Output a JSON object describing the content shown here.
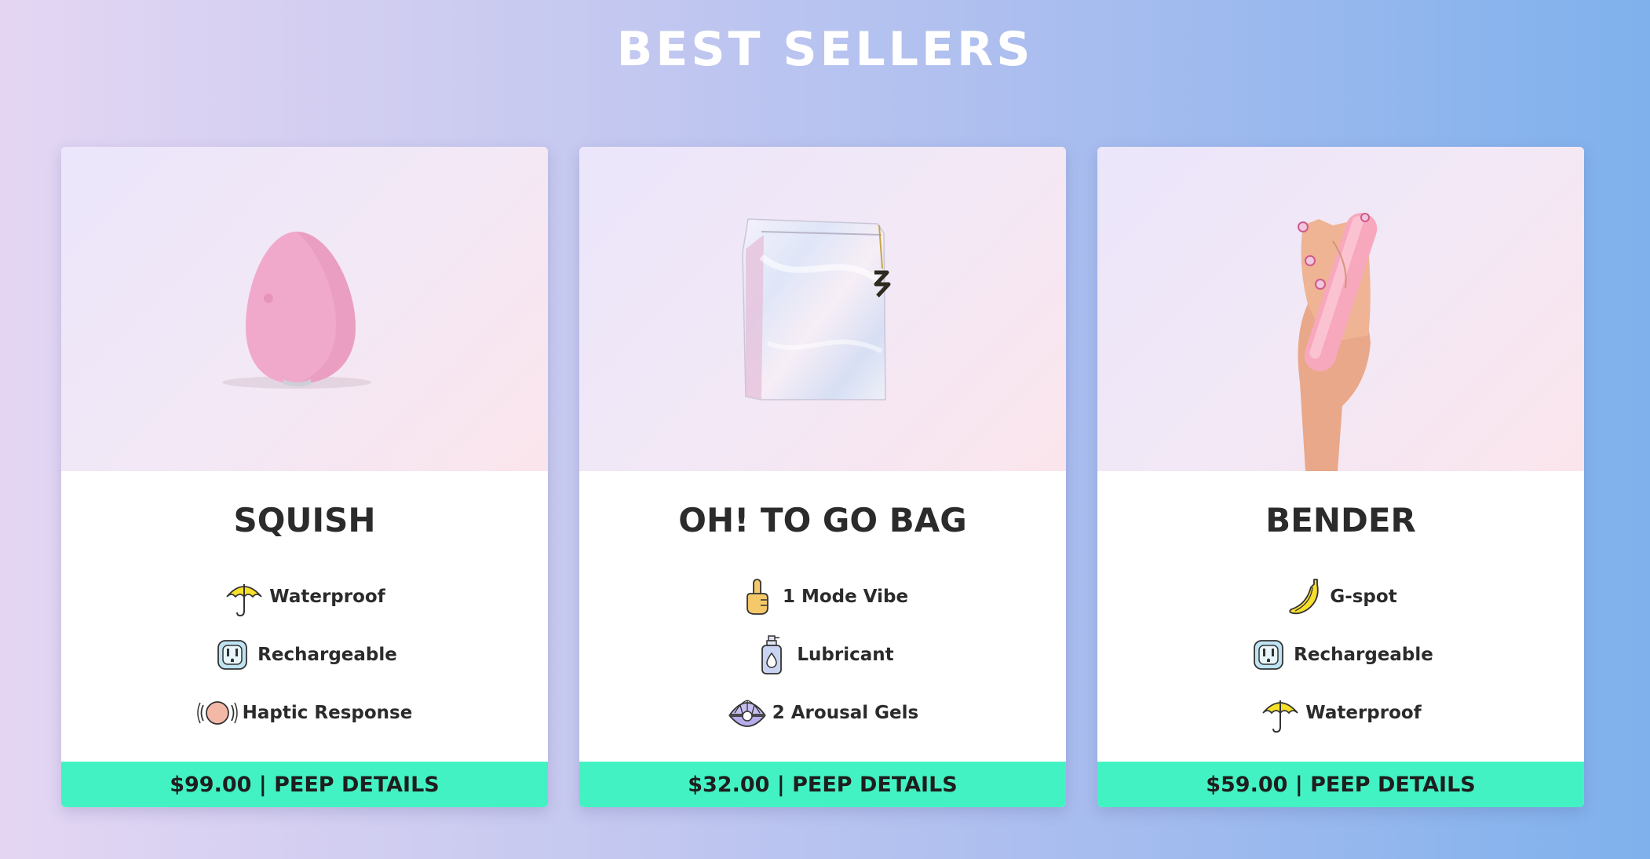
{
  "section": {
    "title": "BEST SELLERS"
  },
  "products": [
    {
      "name": "SQUISH",
      "features": [
        {
          "icon": "umbrella-icon",
          "label": "Waterproof"
        },
        {
          "icon": "outlet-icon",
          "label": "Rechargeable"
        },
        {
          "icon": "haptic-icon",
          "label": "Haptic Response"
        }
      ],
      "price": "$99.00",
      "cta": "PEEP DETAILS"
    },
    {
      "name": "OH! TO GO BAG",
      "features": [
        {
          "icon": "pointing-finger-icon",
          "label": "1 Mode Vibe"
        },
        {
          "icon": "lubricant-bottle-icon",
          "label": "Lubricant"
        },
        {
          "icon": "oyster-pearl-icon",
          "label": "2 Arousal Gels"
        }
      ],
      "price": "$32.00",
      "cta": "PEEP DETAILS"
    },
    {
      "name": "BENDER",
      "features": [
        {
          "icon": "banana-icon",
          "label": "G-spot"
        },
        {
          "icon": "outlet-icon",
          "label": "Rechargeable"
        },
        {
          "icon": "umbrella-icon",
          "label": "Waterproof"
        }
      ],
      "price": "$59.00",
      "cta": "PEEP DETAILS"
    }
  ],
  "separator": " | ",
  "colors": {
    "cta_background": "#43f2c3",
    "title_text": "#ffffff",
    "body_text": "#2b2b2b"
  }
}
